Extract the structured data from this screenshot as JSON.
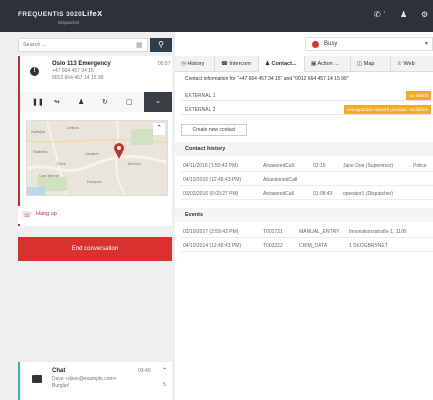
{
  "app": {
    "brand_prefix": "FREQUENTIS 3020",
    "brand_strong": "LifeX",
    "brand_sub": "Dispatcher",
    "top_badge": "1"
  },
  "search": {
    "placeholder": "Search ..."
  },
  "call": {
    "title": "Oslo 113 Emergency",
    "line2": "+47 664 457 34 15",
    "line3": "0012 664 457 14 15 99",
    "time": "00:57",
    "hangup_label": "Hang up",
    "end_label": "End conversation",
    "map_labels": [
      "Saltsjöb.",
      "Lefkus",
      "Stabekk",
      "Grini",
      "Lysaker",
      "Carl Berner",
      "Kampen",
      "Torshov"
    ]
  },
  "chat": {
    "title": "Chat",
    "line2": "Dave <dave@example.com>",
    "line3": "Burglar!",
    "time": "03:40",
    "count": "5"
  },
  "status": {
    "label": "Busy"
  },
  "tabs": [
    {
      "label": "History"
    },
    {
      "label": "Intercom"
    },
    {
      "label": "Contact..."
    },
    {
      "label": "Action ..."
    },
    {
      "label": "Map"
    },
    {
      "label": "Web"
    }
  ],
  "contact": {
    "heading": "Contact information for \"+47 664 457 34 15\" and \"0012 664 457 14 15 99\"",
    "ext1": {
      "label": "EXTERNAL 1",
      "badge": "no match"
    },
    "ext2": {
      "label": "EXTERNAL 2",
      "badge": "unsupported network provider: Vodafone"
    },
    "create_label": "Create new contact"
  },
  "history": {
    "title": "Contact history",
    "rows": [
      [
        "04/11/2016 (1:50:43 PM)",
        "AnsweredCall",
        "02:15",
        "Jane Doe (Supervisor)",
        "Police"
      ],
      [
        "04/10/2016 (12:48:43 PM)",
        "AbandonedCall",
        "",
        "",
        ""
      ],
      [
        "03/03/2016 (6:03:27 PM)",
        "AnsweredCall",
        "01:08:43",
        "operator1 (Dispatcher)",
        ""
      ]
    ]
  },
  "events": {
    "title": "Events",
    "rows": [
      [
        "03/10/2017 (2:59:43 PM)",
        "T001721",
        "MANUAL_ENTRY",
        "Innovationsstraße 1, 1100"
      ],
      [
        "04/10/2014 (12:48:43 PM)",
        "T003222",
        "CRIM_DATA",
        "1 SKOGBRYNET"
      ]
    ]
  },
  "colors": {
    "topbar": "#2e3238",
    "danger": "#d9322e",
    "warning": "#f0ad1f",
    "chat_accent": "#28b6b6"
  }
}
